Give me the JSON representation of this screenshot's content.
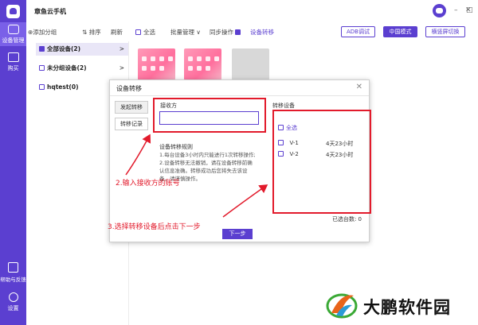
{
  "app": {
    "title": "章鱼云手机"
  },
  "rail": {
    "items": [
      {
        "label": "设备管理",
        "icon": "device-manage-icon"
      },
      {
        "label": "购买",
        "icon": "cart-icon"
      },
      {
        "label": "帮助与反馈",
        "icon": "help-icon"
      },
      {
        "label": "设置",
        "icon": "settings-icon"
      }
    ]
  },
  "window": {
    "minimize": "–",
    "restore": "□",
    "close": "✕"
  },
  "toolbar": {
    "add_group": "⊕添加分组",
    "sort": "⇅ 排序",
    "refresh": "刷新",
    "select_all": "全选",
    "batch": "批量管理 ∨",
    "sync": "同步操作",
    "transfer": "设备转移",
    "adb": "ADB调试",
    "cn_mode": "中国模式",
    "orientation": "横竖屏切换"
  },
  "groups": [
    {
      "label": "全部设备(2)",
      "arrow": ">"
    },
    {
      "label": "未分组设备(2)",
      "arrow": ">"
    },
    {
      "label": "hqtest(0)",
      "arrow": ">"
    }
  ],
  "dialog": {
    "title": "设备转移",
    "close": "✕",
    "tab_initiate": "发起转移",
    "tab_records": "转移记录",
    "receiver_label": "接收方",
    "receiver_value": "",
    "rules_title": "设备转移规则",
    "rules_lines": [
      "1.每台设备3小时内只能进行1次转移操作;",
      "2.设备转移无法撤销，请在设备转移前确",
      "认信息准确。转移成功后您将失去该设",
      "备，请谨慎操作。"
    ],
    "transfer_devices_label": "转移设备",
    "select_all": "全选",
    "devices": [
      {
        "name": "V-1",
        "time": "4天23小时"
      },
      {
        "name": "V-2",
        "time": "4天23小时"
      }
    ],
    "selected_count": "已选台数: 0",
    "next_button": "下一步"
  },
  "annotations": {
    "step2": "2.输入接收方的账号",
    "step3": "3.选择转移设备后点击下一步",
    "color": "#e21a2b"
  },
  "watermark": {
    "text": "大鹏软件园"
  },
  "colors": {
    "accent": "#5b3fd0",
    "annotation": "#e21a2b"
  }
}
